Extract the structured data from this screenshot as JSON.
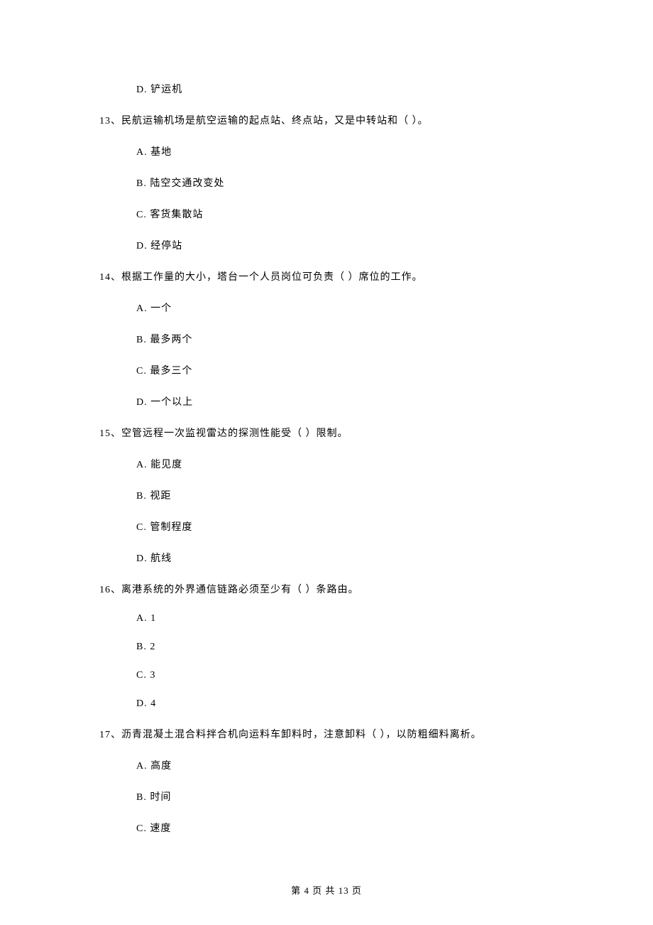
{
  "orphan_option": "D.  铲运机",
  "questions": [
    {
      "stem": "13、民航运输机场是航空运输的起点站、终点站，又是中转站和（    ）。",
      "options": [
        "A.  基地",
        "B.  陆空交通改变处",
        "C.  客货集散站",
        "D.  经停站"
      ]
    },
    {
      "stem": "14、根据工作量的大小，塔台一个人员岗位可负责（    ）席位的工作。",
      "options": [
        "A.  一个",
        "B.  最多两个",
        "C.  最多三个",
        "D.  一个以上"
      ]
    },
    {
      "stem": "15、空管远程一次监视雷达的探测性能受（    ）限制。",
      "options": [
        "A.  能见度",
        "B.  视距",
        "C.  管制程度",
        "D.  航线"
      ]
    },
    {
      "stem": "16、离港系统的外界通信链路必须至少有（    ）条路由。",
      "options": [
        "A.  1",
        "B.  2",
        "C.  3",
        "D.  4"
      ]
    },
    {
      "stem": "17、沥青混凝土混合料拌合机向运料车卸料时，注意卸料（    ），以防粗细料离析。",
      "options": [
        "A.  高度",
        "B.  时间",
        "C.  速度"
      ]
    }
  ],
  "footer": "第 4 页 共 13 页"
}
